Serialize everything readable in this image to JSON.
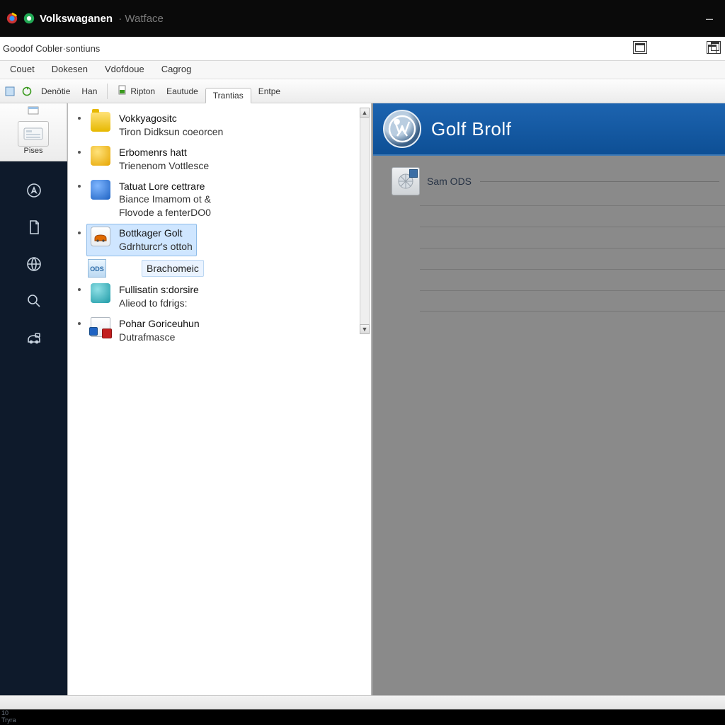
{
  "titlebar": {
    "app_bold": "Volkswaganen",
    "app_suffix": "· Watface",
    "minimize": "–"
  },
  "window": {
    "title": "Goodof Cobler·sontiuns"
  },
  "menubar": [
    "Couet",
    "Dokesen",
    "Vdofdoue",
    "Cagrog"
  ],
  "toolbar": {
    "left_label": "Denötie",
    "small2": "Han",
    "btn1": "Ripton",
    "btn2": "Eautude",
    "tab_active": "Trantias",
    "tab2": "Entpe"
  },
  "leftcol": {
    "big_label": "Pises"
  },
  "tree": {
    "items": [
      {
        "icon": "folder",
        "l1": "Vokkyagositc",
        "l2": "Tiron Didksun coeorcen"
      },
      {
        "icon": "yellow",
        "l1": "Erbomenrs hatt",
        "l2": "Trienenom Vottlesce"
      },
      {
        "icon": "blue",
        "l1": "Tatuat Lore cettrare",
        "l2": "Biance Imamom ot &",
        "l3": "Flovode a fenterDO0"
      },
      {
        "icon": "orange",
        "l1": "Bottkager Golt",
        "l2": "Gdrhturcr's ottoh",
        "selected": true
      },
      {
        "icon": "ods",
        "sub": "Brachomeic"
      },
      {
        "icon": "teal",
        "l1": "Fullisatin s:dorsire",
        "l2": "Alieod to fdrigs:"
      },
      {
        "icon": "red",
        "l1": "Pohar Goriceuhun",
        "l2": "Dutrafmasce"
      }
    ]
  },
  "content": {
    "header_title": "Golf Brolf",
    "sub_label": "Sam ODS",
    "empty_rows": 5
  },
  "footer": {
    "l1": "10",
    "l2": "Tryra"
  }
}
